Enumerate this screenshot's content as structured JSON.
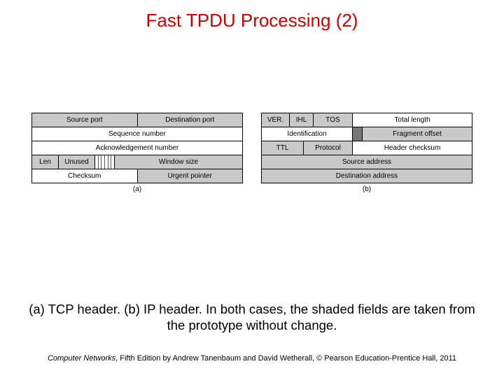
{
  "title": "Fast TPDU Processing (2)",
  "tcp": {
    "r1c1": "Source port",
    "r1c2": "Destination port",
    "r2c1": "Sequence number",
    "r3c1": "Acknowledgement number",
    "r4c1": "Len",
    "r4c2": "Unused",
    "r4c3": "Window size",
    "r5c1": "Checksum",
    "r5c2": "Urgent pointer",
    "caption": "(a)"
  },
  "ip": {
    "r1c1": "VER.",
    "r1c2": "IHL",
    "r1c3": "TOS",
    "r1c4": "Total length",
    "r2c1": "Identification",
    "r2c2": "Fragment offset",
    "r3c1": "TTL",
    "r3c2": "Protocol",
    "r3c3": "Header checksum",
    "r4c1": "Source address",
    "r5c1": "Destination address",
    "caption": "(b)"
  },
  "description": "(a) TCP header. (b) IP header. In both cases, the shaded fields are taken from the prototype without change.",
  "credit_book": "Computer Networks",
  "credit_rest": ", Fifth Edition by Andrew Tanenbaum and David Wetherall, © Pearson Education-Prentice Hall, 2011"
}
